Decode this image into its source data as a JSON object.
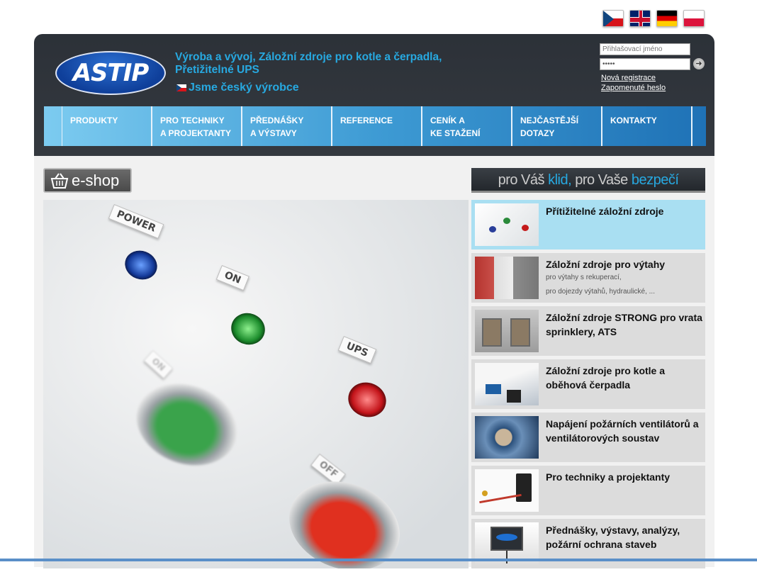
{
  "flags": [
    "czech-flag-icon",
    "english-flag-icon",
    "german-flag-icon",
    "polish-flag-icon"
  ],
  "header": {
    "logo_text": "ASTIP",
    "tagline_line1": "Výroba a vývoj, Záložní zdroje pro kotle a čerpadla,",
    "tagline_line2": "Přetižitelné UPS",
    "made_in": "Jsme český výrobce"
  },
  "login": {
    "username_placeholder": "Přihlašovací jméno",
    "password_value": "•••••",
    "register_link": "Nová registrace",
    "forgot_link": "Zapomenuté heslo"
  },
  "nav": [
    {
      "label": "PRODUKTY"
    },
    {
      "label": "PRO TECHNIKY\nA PROJEKTANTY"
    },
    {
      "label": "PŘEDNÁŠKY\nA VÝSTAVY"
    },
    {
      "label": "REFERENCE"
    },
    {
      "label": "CENÍK A\nKE STAŽENÍ"
    },
    {
      "label": "NEJČASTĚJŠÍ\nDOTAZY"
    },
    {
      "label": "KONTAKTY"
    }
  ],
  "eshop": {
    "label": "e-shop"
  },
  "slogan": {
    "part1": "pro Váš ",
    "acc1": "klid,",
    "part2": " pro Vaše ",
    "acc2": "bezpečí"
  },
  "hero": {
    "labels": [
      "POWER",
      "ON",
      "UPS",
      "ON",
      "OFF"
    ]
  },
  "categories": [
    {
      "title": "Přítižitelné záložní zdroje",
      "subs": []
    },
    {
      "title": "Záložní zdroje pro výtahy",
      "subs": [
        "pro výtahy s rekuperací,",
        "pro dojezdy výtahů, hydraulické, ..."
      ]
    },
    {
      "title": "Záložní zdroje STRONG pro vrata sprinklery, ATS",
      "subs": []
    },
    {
      "title": "Záložní zdroje pro kotle a oběhová čerpadla",
      "subs": []
    },
    {
      "title": "Napájení požárních ventilátorů a ventilátorových soustav",
      "subs": []
    },
    {
      "title": "Pro techniky a projektanty",
      "subs": []
    },
    {
      "title": "Přednášky, výstavy, analýzy, požární ochrana staveb",
      "subs": []
    }
  ]
}
